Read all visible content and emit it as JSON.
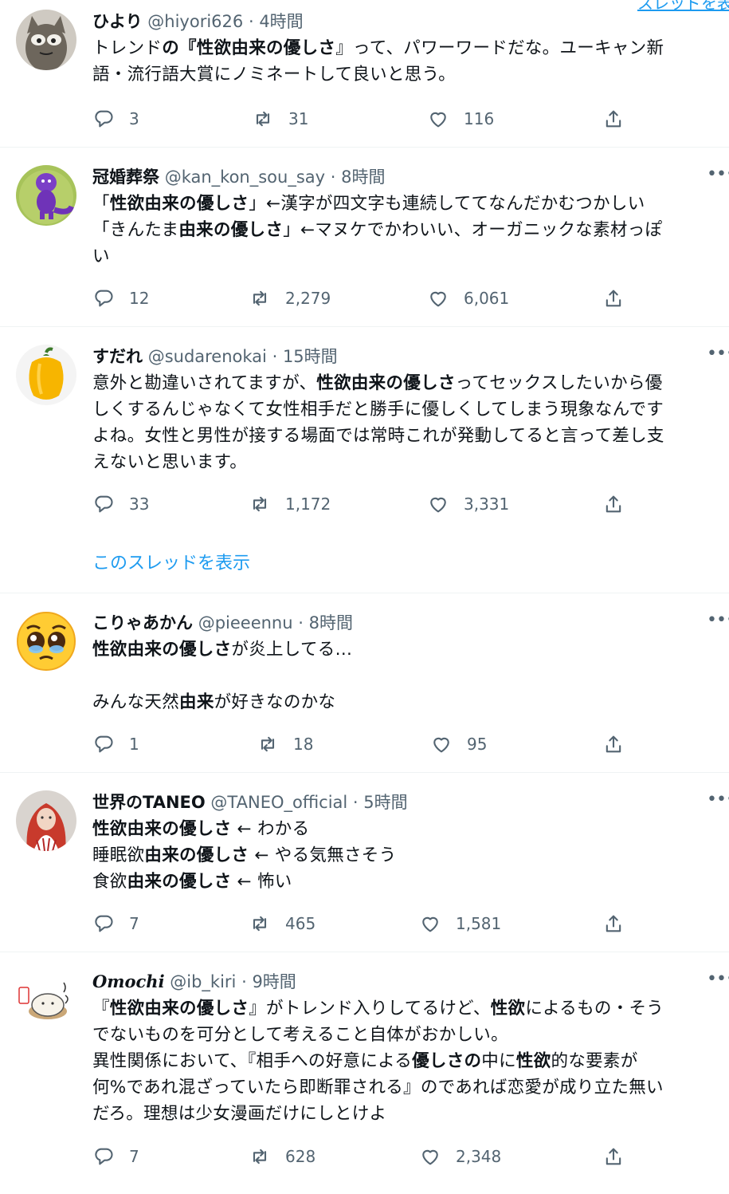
{
  "top_link": "スレッドを表示",
  "thread_link": "このスレッドを表示",
  "tweets": [
    {
      "name": "ひより",
      "handle": "@hiyori626",
      "time": "4時間",
      "avatar": "cat-avatar",
      "lines": [
        [
          {
            "t": "トレンド"
          },
          {
            "t": "の『性欲由来の優しさ",
            "b": true
          },
          {
            "t": "』って、パワーワードだな。ユーキャン新"
          }
        ],
        [
          {
            "t": "語・流行語大賞にノミネートして良いと思う。"
          }
        ]
      ],
      "replies": "3",
      "retweets": "31",
      "likes": "116"
    },
    {
      "name": "冠婚葬祭",
      "handle": "@kan_kon_sou_say",
      "time": "8時間",
      "avatar": "purple-dino-avatar",
      "lines": [
        [
          {
            "t": "「"
          },
          {
            "t": "性欲由来の優しさ",
            "b": true
          },
          {
            "t": "」←漢字が四文字も連続しててなんだかむつかしい"
          }
        ],
        [
          {
            "t": "「きんたま"
          },
          {
            "t": "由来の優しさ",
            "b": true
          },
          {
            "t": "」←マヌケでかわいい、オーガニックな素材っぽ"
          }
        ],
        [
          {
            "t": "い"
          }
        ]
      ],
      "replies": "12",
      "retweets": "2,279",
      "likes": "6,061"
    },
    {
      "name": "すだれ",
      "handle": "@sudarenokai",
      "time": "15時間",
      "avatar": "yellow-pepper-avatar",
      "lines": [
        [
          {
            "t": "意外と勘違いされてますが、"
          },
          {
            "t": "性欲由来の優しさ",
            "b": true
          },
          {
            "t": "ってセックスしたいから優"
          }
        ],
        [
          {
            "t": "しくするんじゃなくて女性相手だと勝手に優しくしてしまう現象なんです"
          }
        ],
        [
          {
            "t": "よね。女性と男性が接する場面では常時これが発動してると言って差し支"
          }
        ],
        [
          {
            "t": "えないと思います。"
          }
        ]
      ],
      "replies": "33",
      "retweets": "1,172",
      "likes": "3,331"
    },
    {
      "name": "こりゃあかん",
      "handle": "@pieeennu",
      "time": "8時間",
      "avatar": "pleading-emoji-avatar",
      "lines": [
        [
          {
            "t": "性欲由来の優しさ",
            "b": true
          },
          {
            "t": "が炎上してる…"
          }
        ],
        [
          {
            "t": ""
          }
        ],
        [
          {
            "t": "みんな天然"
          },
          {
            "t": "由来",
            "b": true
          },
          {
            "t": "が好きなのかな"
          }
        ]
      ],
      "replies": "1",
      "retweets": "18",
      "likes": "95"
    },
    {
      "name": "世界のTANEO",
      "handle": "@TANEO_official",
      "time": "5時間",
      "avatar": "red-hair-avatar",
      "lines": [
        [
          {
            "t": "性欲由来の優しさ",
            "b": true
          },
          {
            "t": " ← わかる"
          }
        ],
        [
          {
            "t": "睡眠欲"
          },
          {
            "t": "由来の優しさ",
            "b": true
          },
          {
            "t": " ← やる気無さそう"
          }
        ],
        [
          {
            "t": "食欲"
          },
          {
            "t": "由来の優しさ",
            "b": true
          },
          {
            "t": " ← 怖い"
          }
        ]
      ],
      "replies": "7",
      "retweets": "465",
      "likes": "1,581"
    },
    {
      "name": "Omochi",
      "handle": "@ib_kiri",
      "time": "9時間",
      "avatar": "omochi-avatar",
      "lines": [
        [
          {
            "t": "『"
          },
          {
            "t": "性欲由来の優しさ",
            "b": true
          },
          {
            "t": "』がトレンド入りしてるけど、"
          },
          {
            "t": "性欲",
            "b": true
          },
          {
            "t": "によるもの・そう"
          }
        ],
        [
          {
            "t": "でないものを可分として考えること自体がおかしい。"
          }
        ],
        [
          {
            "t": "異性関係において、『相手への好意による"
          },
          {
            "t": "優しさの",
            "b": true
          },
          {
            "t": "中に"
          },
          {
            "t": "性欲",
            "b": true
          },
          {
            "t": "的な要素が"
          }
        ],
        [
          {
            "t": "何%であれ混ざっていたら即断罪される』のであれば恋愛が成り立た無い"
          }
        ],
        [
          {
            "t": "だろ。理想は少女漫画だけにしとけよ"
          }
        ]
      ],
      "replies": "7",
      "retweets": "628",
      "likes": "2,348"
    }
  ]
}
